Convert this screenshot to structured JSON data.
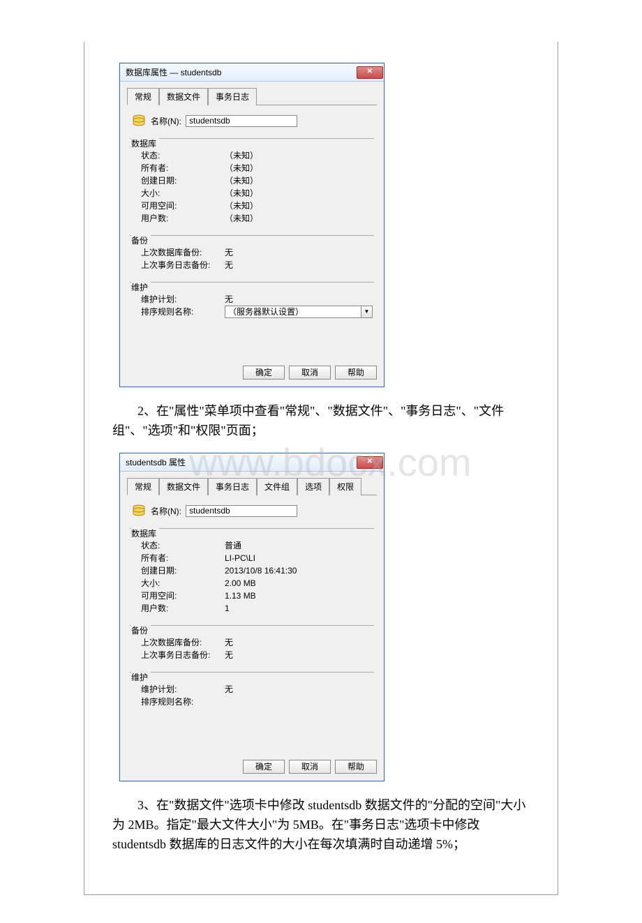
{
  "watermark": "www.bdocx.com",
  "dialog1": {
    "title": "数据库属性 — studentsdb",
    "close": "✕",
    "tabs": [
      "常规",
      "数据文件",
      "事务日志"
    ],
    "name_label": "名称(N):",
    "name_value": "studentsdb",
    "groups": {
      "db": {
        "title": "数据库",
        "rows": [
          {
            "k": "状态:",
            "v": "（未知）"
          },
          {
            "k": "所有者:",
            "v": "（未知）"
          },
          {
            "k": "创建日期:",
            "v": "（未知）"
          },
          {
            "k": "大小:",
            "v": "（未知）"
          },
          {
            "k": "可用空间:",
            "v": "（未知）"
          },
          {
            "k": "用户数:",
            "v": "（未知）"
          }
        ]
      },
      "backup": {
        "title": "备份",
        "rows": [
          {
            "k": "上次数据库备份:",
            "v": "无"
          },
          {
            "k": "上次事务日志备份:",
            "v": "无"
          }
        ]
      },
      "maint": {
        "title": "维护",
        "rows": [
          {
            "k": "维护计划:",
            "v": "无"
          },
          {
            "k": "排序规则名称:",
            "v": "（服务器默认设置）"
          }
        ]
      }
    },
    "buttons": {
      "ok": "确定",
      "cancel": "取消",
      "help": "帮助"
    }
  },
  "para1": "2、在\"属性\"菜单项中查看\"常规\"、\"数据文件\"、\"事务日志\"、\"文件组\"、\"选项\"和\"权限\"页面；",
  "dialog2": {
    "title": "studentsdb 属性",
    "close": "✕",
    "tabs": [
      "常规",
      "数据文件",
      "事务日志",
      "文件组",
      "选项",
      "权限"
    ],
    "name_label": "名称(N):",
    "name_value": "studentsdb",
    "groups": {
      "db": {
        "title": "数据库",
        "rows": [
          {
            "k": "状态:",
            "v": "普通"
          },
          {
            "k": "所有者:",
            "v": "LI-PC\\LI"
          },
          {
            "k": "创建日期:",
            "v": "2013/10/8 16:41:30"
          },
          {
            "k": "大小:",
            "v": "2.00 MB"
          },
          {
            "k": "可用空间:",
            "v": "1.13 MB"
          },
          {
            "k": "用户数:",
            "v": "1"
          }
        ]
      },
      "backup": {
        "title": "备份",
        "rows": [
          {
            "k": "上次数据库备份:",
            "v": "无"
          },
          {
            "k": "上次事务日志备份:",
            "v": "无"
          }
        ]
      },
      "maint": {
        "title": "维护",
        "rows": [
          {
            "k": "维护计划:",
            "v": "无"
          },
          {
            "k": "排序规则名称:",
            "v": ""
          }
        ]
      }
    },
    "buttons": {
      "ok": "确定",
      "cancel": "取消",
      "help": "帮助"
    }
  },
  "para2": "3、在\"数据文件\"选项卡中修改 studentsdb 数据文件的\"分配的空间\"大小为 2MB。指定\"最大文件大小\"为 5MB。在\"事务日志\"选项卡中修改studentsdb 数据库的日志文件的大小在每次填满时自动递增 5%；"
}
